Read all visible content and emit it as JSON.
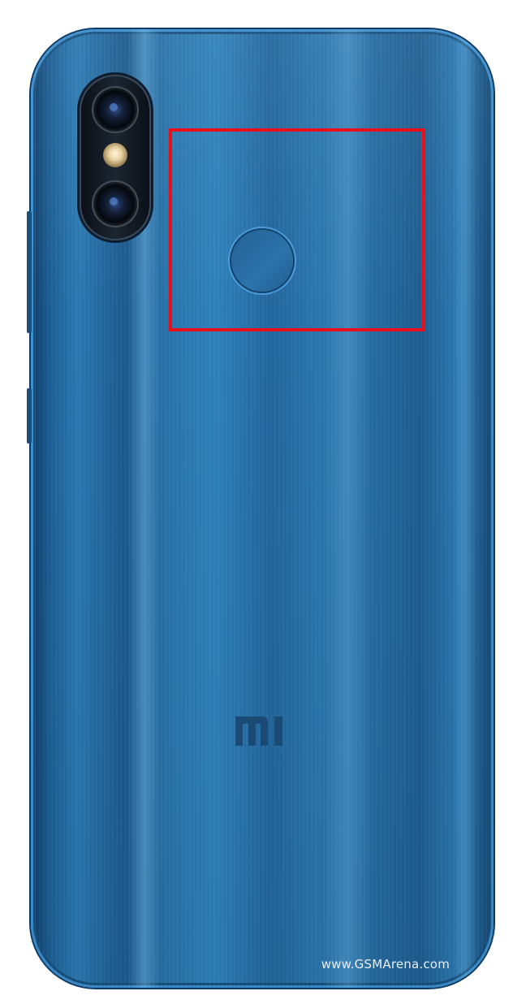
{
  "image": {
    "subject": "phone-back",
    "body_color": "#2b74ab",
    "highlight_color": "#e8101a",
    "brand_logo_text": "MI",
    "watermark_text": "www.GSMArena.com"
  }
}
